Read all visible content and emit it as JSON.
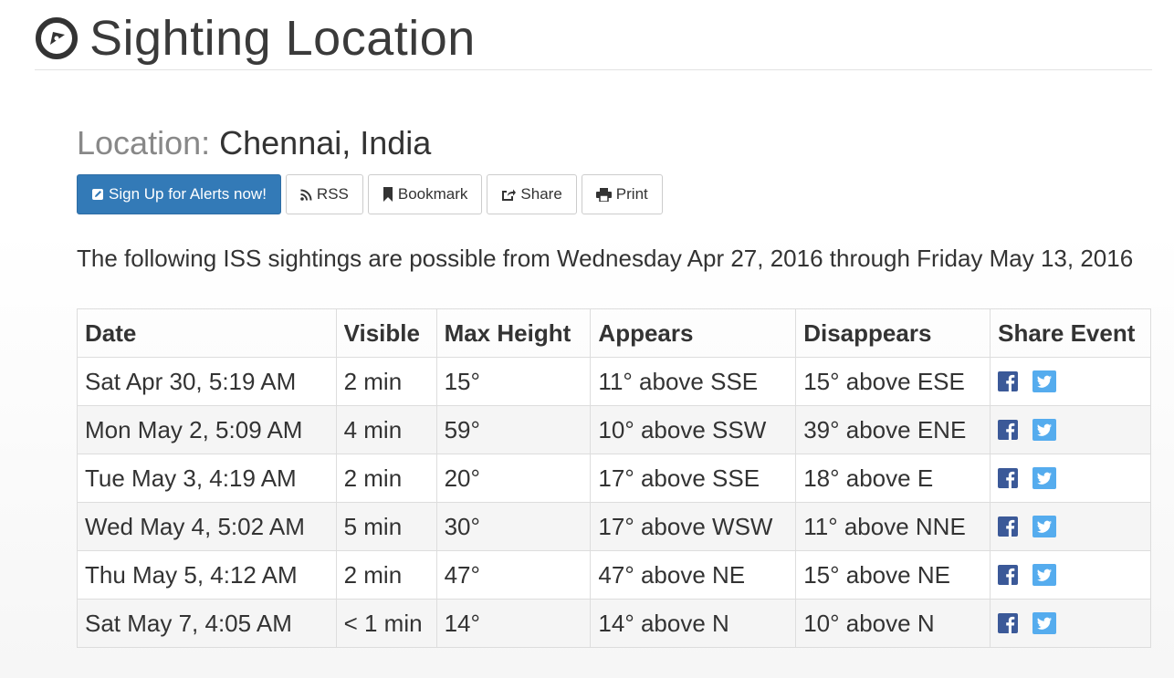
{
  "header": {
    "title": "Sighting Location",
    "logo_icon": "compass-icon"
  },
  "location": {
    "label": "Location:",
    "value": "Chennai, India"
  },
  "buttons": {
    "signup": "Sign Up for Alerts now!",
    "rss": "RSS",
    "bookmark": "Bookmark",
    "share": "Share",
    "print": "Print"
  },
  "intro": "The following ISS sightings are possible from Wednesday Apr 27, 2016 through Friday May 13, 2016",
  "table": {
    "headers": [
      "Date",
      "Visible",
      "Max Height",
      "Appears",
      "Disappears",
      "Share Event"
    ],
    "rows": [
      [
        "Sat Apr 30, 5:19 AM",
        "2 min",
        "15°",
        "11° above SSE",
        "15° above ESE"
      ],
      [
        "Mon May 2, 5:09 AM",
        "4 min",
        "59°",
        "10° above SSW",
        "39° above ENE"
      ],
      [
        "Tue May 3, 4:19 AM",
        "2 min",
        "20°",
        "17° above SSE",
        "18° above E"
      ],
      [
        "Wed May 4, 5:02 AM",
        "5 min",
        "30°",
        "17° above WSW",
        "11° above NNE"
      ],
      [
        "Thu May 5, 4:12 AM",
        "2 min",
        "47°",
        "47° above NE",
        "15° above NE"
      ],
      [
        "Sat May 7, 4:05 AM",
        "< 1 min",
        "14°",
        "14° above N",
        "10° above N"
      ]
    ]
  },
  "colors": {
    "primary": "#337ab7",
    "facebook": "#3b5998",
    "twitter": "#55acee"
  }
}
